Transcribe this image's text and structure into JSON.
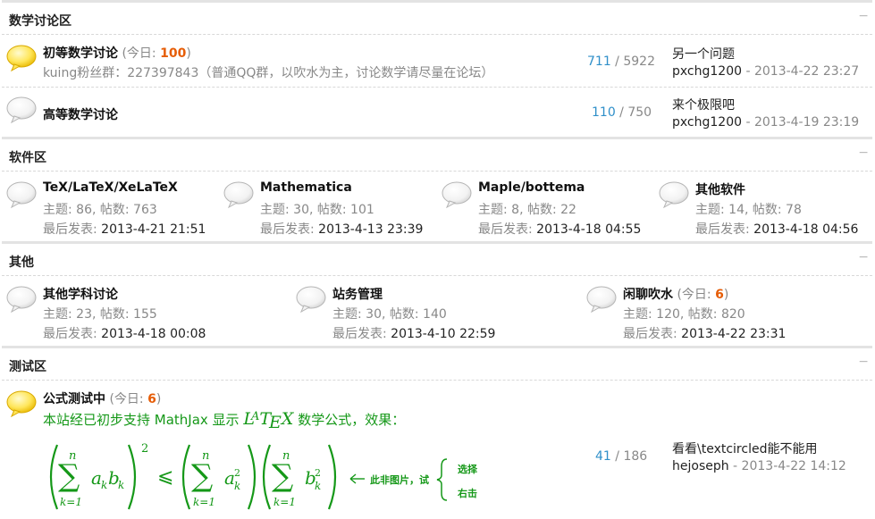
{
  "sections": {
    "math": {
      "title": "数学讨论区",
      "forums": [
        {
          "name": "初等数学讨论",
          "today_label": "(今日: ",
          "today_count": "100",
          "today_close": ")",
          "desc": "kuing粉丝群：227397843（普通QQ群，以吹水为主，讨论数学请尽量在论坛）",
          "threads": "711",
          "sep": " / ",
          "posts": "5922",
          "last_title": "另一个问题",
          "last_user": "pxchg1200",
          "last_date": " - 2013-4-22 23:27"
        },
        {
          "name": "高等数学讨论",
          "threads": "110",
          "sep": " / ",
          "posts": "750",
          "last_title": "来个极限吧",
          "last_user": "pxchg1200",
          "last_date": " - 2013-4-19 23:19"
        }
      ]
    },
    "software": {
      "title": "软件区",
      "forums": [
        {
          "name": "TeX/LaTeX/XeLaTeX",
          "stats": "主题: 86, 帖数: 763",
          "last_label": "最后发表: ",
          "last_date": "2013-4-21 21:51"
        },
        {
          "name": "Mathematica",
          "stats": "主题: 30, 帖数: 101",
          "last_label": "最后发表: ",
          "last_date": "2013-4-13 23:39"
        },
        {
          "name": "Maple/bottema",
          "stats": "主题: 8, 帖数: 22",
          "last_label": "最后发表: ",
          "last_date": "2013-4-18 04:55"
        },
        {
          "name": "其他软件",
          "stats": "主题: 14, 帖数: 78",
          "last_label": "最后发表: ",
          "last_date": "2013-4-18 04:56"
        }
      ]
    },
    "other": {
      "title": "其他",
      "forums": [
        {
          "name": "其他学科讨论",
          "stats": "主题: 23, 帖数: 155",
          "last_label": "最后发表: ",
          "last_date": "2013-4-18 00:08"
        },
        {
          "name": "站务管理",
          "stats": "主题: 30, 帖数: 140",
          "last_label": "最后发表: ",
          "last_date": "2013-4-10 22:59"
        },
        {
          "name": "闲聊吹水",
          "today_label": "(今日: ",
          "today_count": "6",
          "today_close": ")",
          "stats": "主题: 120, 帖数: 820",
          "last_label": "最后发表: ",
          "last_date": "2013-4-22 23:31"
        }
      ]
    },
    "test": {
      "title": "测试区",
      "forum": {
        "name": "公式测试中",
        "today_label": "(今日: ",
        "today_count": "6",
        "today_close": ")",
        "desc_prefix": "本站经已初步支持 MathJax 显示 ",
        "desc_suffix": " 数学公式，效果：",
        "threads": "41",
        "sep": " / ",
        "posts": "186",
        "last_title": "看看\\textcircled能不能用",
        "last_user": "hejoseph",
        "last_date": " - 2013-4-22 14:12"
      },
      "formula": {
        "sum_top": "n",
        "sum_bottom": "k=1",
        "lhs_term": "a",
        "lhs_sub": "k",
        "lhs_term2": "b",
        "lhs_sub2": "k",
        "power": "2",
        "leq": "⩽",
        "rhs_term1": "a",
        "rhs_sub1": "k",
        "rhs_sup1": "2",
        "rhs_term2": "b",
        "rhs_sub2": "k",
        "rhs_sup2": "2",
        "note": "此非图片，试",
        "opt1": "选择",
        "opt2": "右击"
      }
    }
  },
  "collapse_symbol": "−",
  "latex_logo": "LATEX",
  "colors": {
    "accent_blue": "#2f8fc9",
    "today_orange": "#e65d07",
    "formula_green": "#159818",
    "separator": "#e3e3e3"
  }
}
